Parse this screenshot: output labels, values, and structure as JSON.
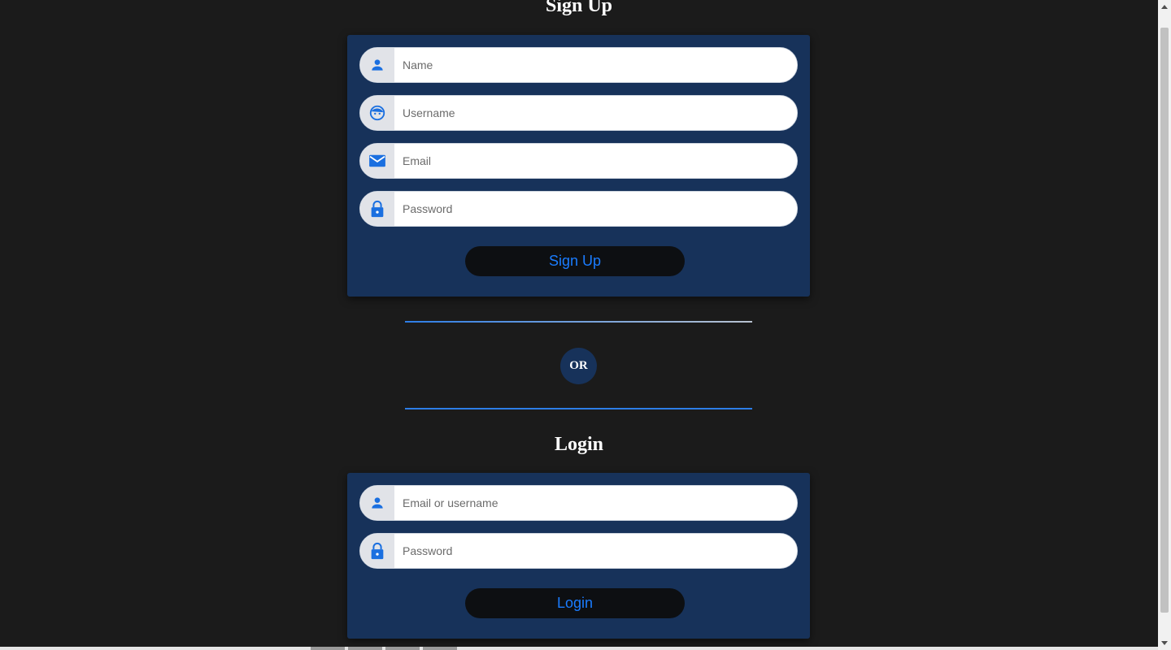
{
  "signup": {
    "title": "Sign Up",
    "fields": [
      {
        "icon": "person-icon",
        "placeholder": "Name"
      },
      {
        "icon": "face-icon",
        "placeholder": "Username"
      },
      {
        "icon": "envelope-icon",
        "placeholder": "Email"
      },
      {
        "icon": "lock-icon",
        "placeholder": "Password"
      }
    ],
    "button_label": "Sign Up"
  },
  "separator": {
    "label": "OR"
  },
  "login": {
    "title": "Login",
    "fields": [
      {
        "icon": "person-icon",
        "placeholder": "Email or username"
      },
      {
        "icon": "lock-icon",
        "placeholder": "Password"
      }
    ],
    "button_label": "Login"
  },
  "colors": {
    "background": "#1b1b1b",
    "card": "#17325a",
    "accent": "#1a7cff",
    "button": "#0d0f12"
  }
}
